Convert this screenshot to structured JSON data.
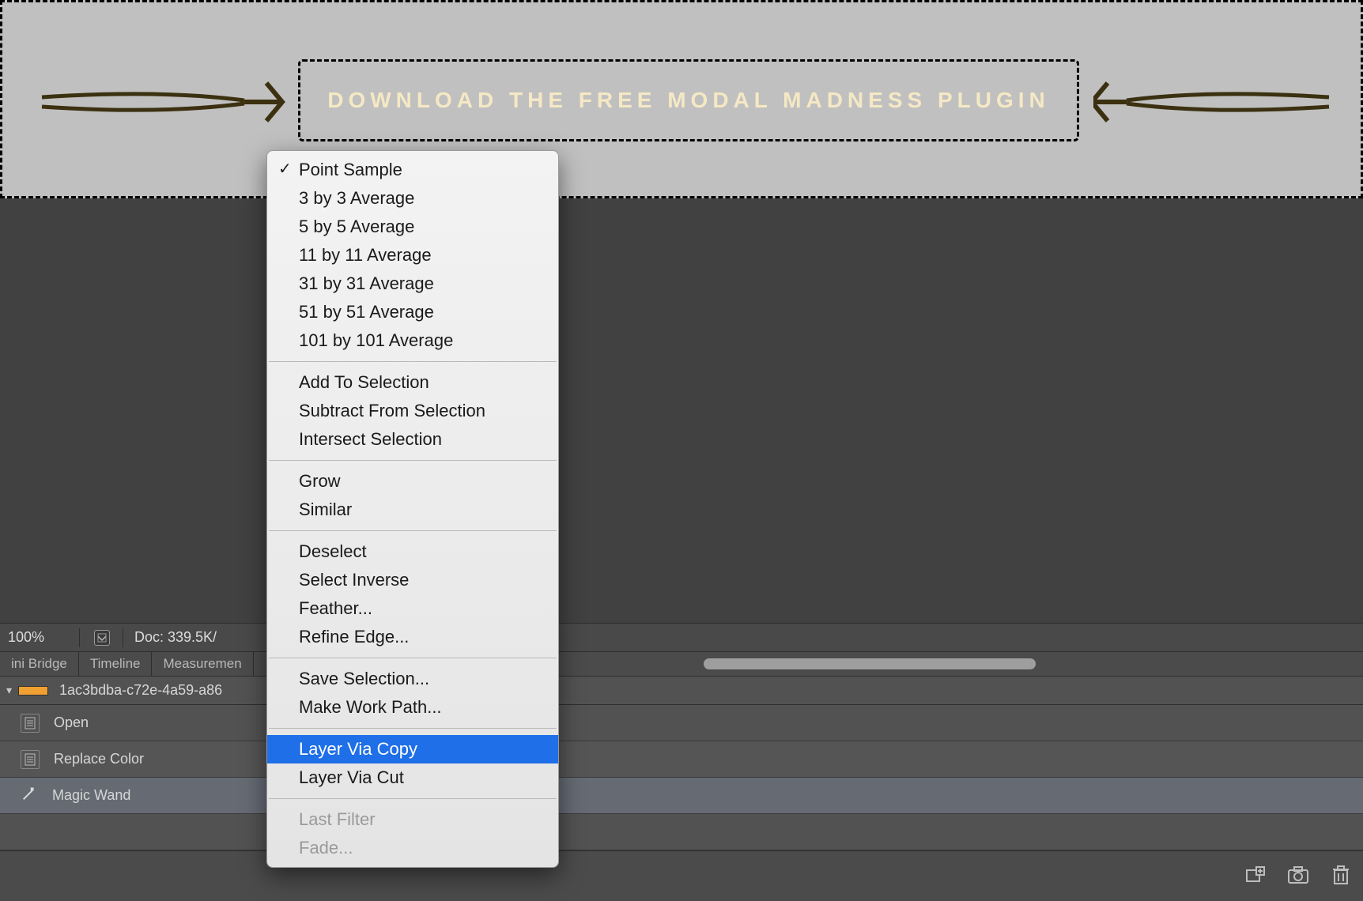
{
  "banner": {
    "button_label": "DOWNLOAD THE FREE MODAL MADNESS PLUGIN"
  },
  "status": {
    "zoom": "100%",
    "doc_size": "Doc: 339.5K/"
  },
  "tabs": {
    "items": [
      "ini Bridge",
      "Timeline",
      "Measuremen"
    ]
  },
  "file": {
    "name": "1ac3bdba-c72e-4a59-a86"
  },
  "actions": {
    "items": [
      "Open",
      "Replace Color",
      "Magic Wand"
    ],
    "selected_index": 2
  },
  "context_menu": {
    "groups": [
      [
        {
          "label": "Point Sample",
          "checked": true
        },
        {
          "label": "3 by 3 Average"
        },
        {
          "label": "5 by 5 Average"
        },
        {
          "label": "11 by 11 Average"
        },
        {
          "label": "31 by 31 Average"
        },
        {
          "label": "51 by 51 Average"
        },
        {
          "label": "101 by 101 Average"
        }
      ],
      [
        {
          "label": "Add To Selection"
        },
        {
          "label": "Subtract From Selection"
        },
        {
          "label": "Intersect Selection"
        }
      ],
      [
        {
          "label": "Grow"
        },
        {
          "label": "Similar"
        }
      ],
      [
        {
          "label": "Deselect"
        },
        {
          "label": "Select Inverse"
        },
        {
          "label": "Feather..."
        },
        {
          "label": "Refine Edge..."
        }
      ],
      [
        {
          "label": "Save Selection..."
        },
        {
          "label": "Make Work Path..."
        }
      ],
      [
        {
          "label": "Layer Via Copy",
          "highlight": true
        },
        {
          "label": "Layer Via Cut"
        }
      ],
      [
        {
          "label": "Last Filter",
          "disabled": true
        },
        {
          "label": "Fade...",
          "disabled": true
        }
      ]
    ]
  }
}
